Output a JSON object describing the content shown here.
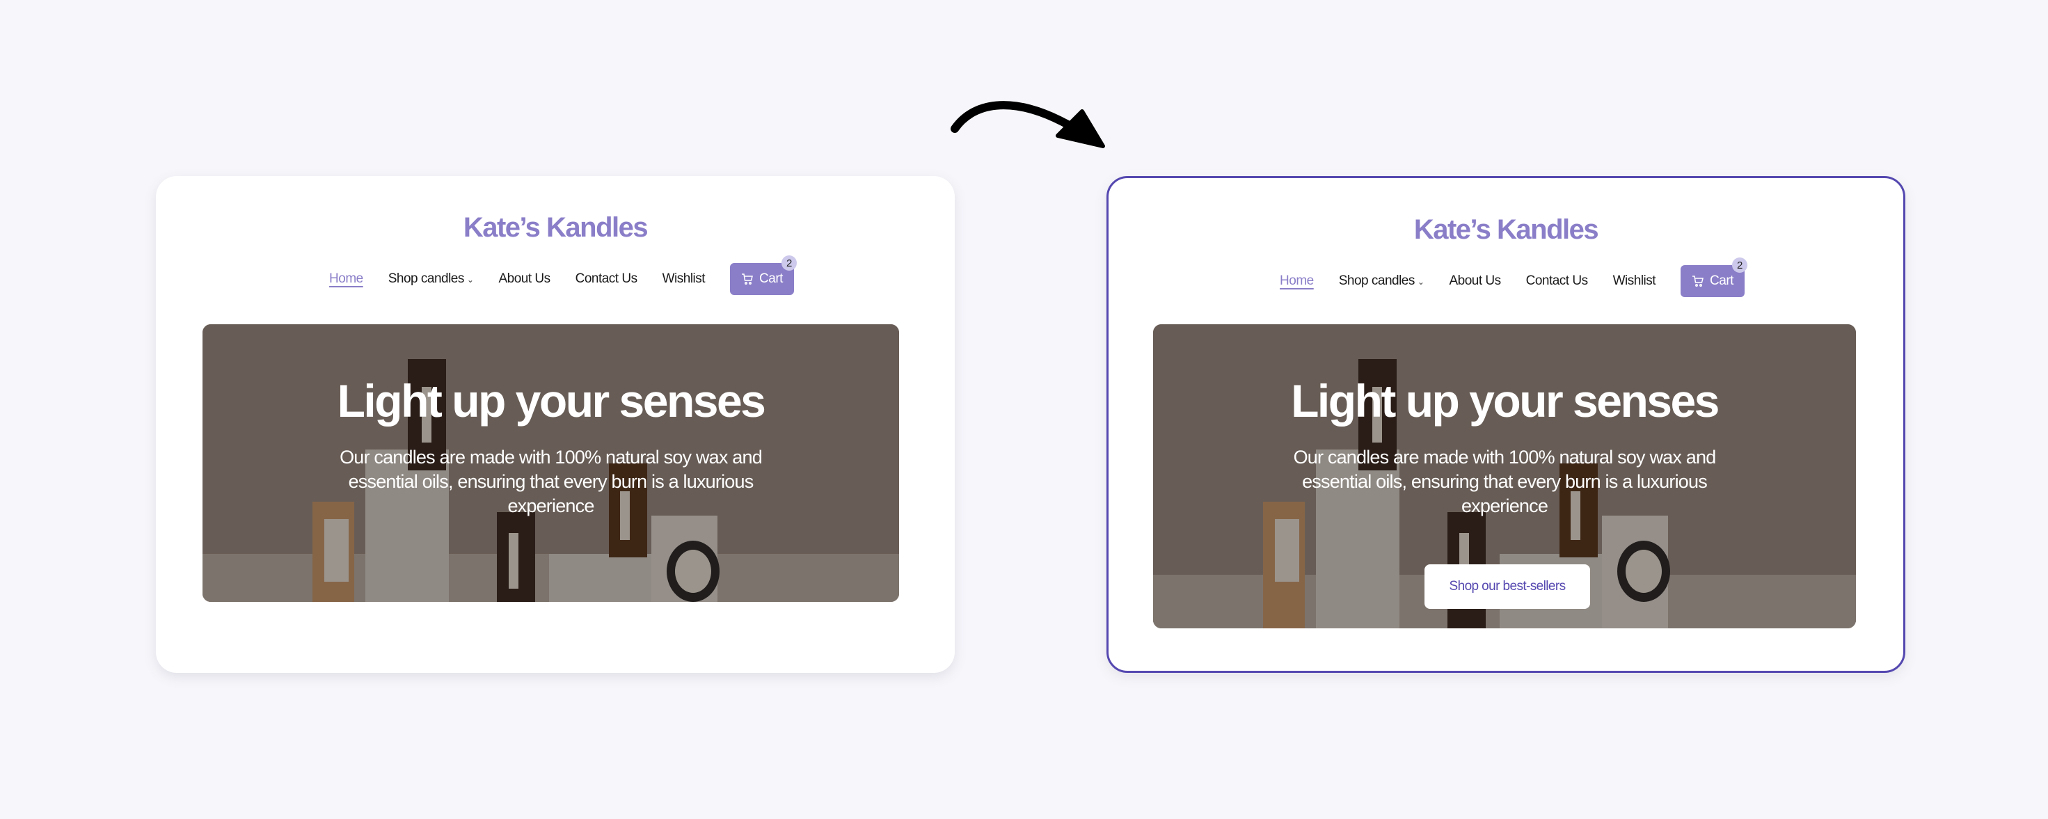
{
  "comparison": {
    "arrow_icon": "curved-arrow-right",
    "before": {
      "logo": "Kate’s Kandles",
      "nav": {
        "items": [
          {
            "label": "Home",
            "active": true
          },
          {
            "label": "Shop candles",
            "has_dropdown": true,
            "dropdown_glyph": "⌄"
          },
          {
            "label": "About Us"
          },
          {
            "label": "Contact Us"
          },
          {
            "label": "Wishlist"
          }
        ],
        "cart": {
          "label": "Cart",
          "icon": "cart-icon",
          "count": "2"
        }
      },
      "hero": {
        "title": "Light up your senses",
        "subtitle": "Our candles are made with 100% natural soy wax and essential oils, ensuring that every burn is a luxurious experience"
      }
    },
    "after": {
      "logo": "Kate’s Kandles",
      "nav": {
        "items": [
          {
            "label": "Home",
            "active": true
          },
          {
            "label": "Shop candles",
            "has_dropdown": true,
            "dropdown_glyph": "⌄"
          },
          {
            "label": "About Us"
          },
          {
            "label": "Contact Us"
          },
          {
            "label": "Wishlist"
          }
        ],
        "cart": {
          "label": "Cart",
          "icon": "cart-icon",
          "count": "2"
        }
      },
      "hero": {
        "title": "Light up your senses",
        "subtitle": "Our candles are made with 100% natural soy wax and essential oils, ensuring that every burn is a luxurious experience",
        "cta_label": "Shop our best-sellers"
      }
    }
  },
  "colors": {
    "brand": "#8a7ec8",
    "highlight_border": "#5548b0",
    "badge": "#cdc9ec",
    "background": "#f7f7fb"
  }
}
